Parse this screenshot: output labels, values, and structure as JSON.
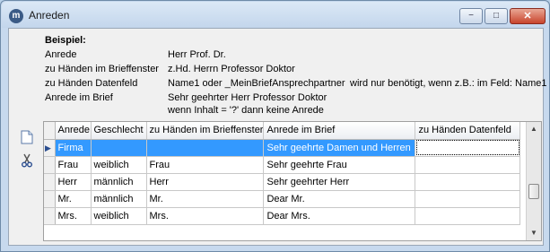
{
  "window": {
    "title": "Anreden",
    "app_icon_letter": "m",
    "minimize_glyph": "−",
    "maximize_glyph": "□",
    "close_glyph": "✕"
  },
  "example": {
    "heading": "Beispiel:",
    "rows": [
      {
        "label": "Anrede",
        "value": "Herr Prof. Dr."
      },
      {
        "label": "zu Händen im Brieffenster",
        "value": "z.Hd. Herrn Professor Doktor"
      },
      {
        "label": "zu Händen Datenfeld",
        "value": "Name1 oder _MeinBriefAnsprechpartner"
      },
      {
        "label": "Anrede im Brief",
        "value": "Sehr geehrter Herr Professor Doktor"
      }
    ],
    "value_extra": "wenn Inhalt = '?' dann keine Anrede",
    "note": "wird nur benötigt, wenn z.B.: im Feld: Name1"
  },
  "toolbar": {
    "new_icon": "new-document-icon",
    "cut_icon": "scissors-icon"
  },
  "grid": {
    "columns": [
      "Anrede",
      "Geschlecht",
      "zu Händen im Brieffenster",
      "Anrede im Brief",
      "zu Händen Datenfeld"
    ],
    "rows": [
      [
        "Firma",
        "",
        "",
        "Sehr geehrte Damen und Herren",
        ""
      ],
      [
        "Frau",
        "weiblich",
        "Frau",
        "Sehr geehrte Frau",
        ""
      ],
      [
        "Herr",
        "männlich",
        "Herr",
        "Sehr geehrter Herr",
        ""
      ],
      [
        "Mr.",
        "männlich",
        "Mr.",
        "Dear Mr.",
        ""
      ],
      [
        "Mrs.",
        "weiblich",
        "Mrs.",
        "Dear Mrs.",
        ""
      ]
    ],
    "selected_row": 0,
    "current_row_marker": "▶",
    "scroll_position": 0.45
  },
  "colors": {
    "selection": "#3399ff",
    "title_bar": "#c3d6ec",
    "close_button": "#c8442c"
  }
}
